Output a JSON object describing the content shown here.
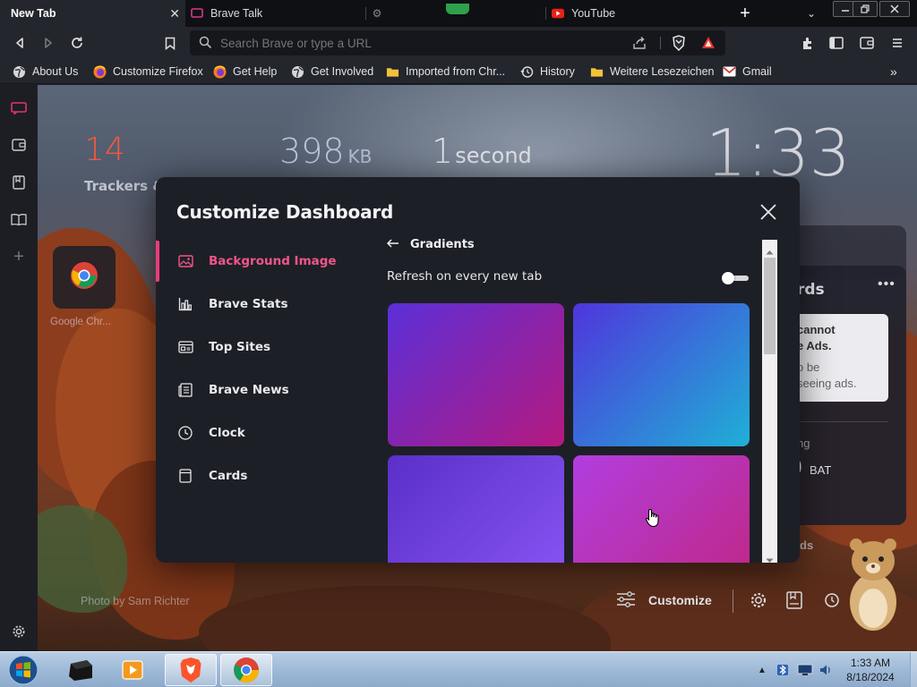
{
  "tabs": [
    {
      "label": "New Tab",
      "active": true
    },
    {
      "label": "Brave Talk",
      "active": false
    },
    {
      "label": "",
      "active": false
    },
    {
      "label": "YouTube",
      "active": false
    }
  ],
  "toolbar": {
    "url_placeholder": "Search Brave or type a URL"
  },
  "bookmarks": [
    {
      "label": "About Us",
      "icon": "globe-icon"
    },
    {
      "label": "Customize Firefox",
      "icon": "firefox-icon"
    },
    {
      "label": "Get Help",
      "icon": "firefox-icon"
    },
    {
      "label": "Get Involved",
      "icon": "globe-icon"
    },
    {
      "label": "Imported from Chr...",
      "icon": "folder-icon"
    },
    {
      "label": "History",
      "icon": "history-icon"
    },
    {
      "label": "Weitere Lesezeichen",
      "icon": "folder-icon"
    },
    {
      "label": "Gmail",
      "icon": "gmail-icon"
    }
  ],
  "background": {
    "stats": {
      "trackers_count": "14",
      "trackers_label": "Trackers &",
      "bandwidth_value": "398",
      "bandwidth_unit": "KB",
      "time_value": "1",
      "time_unit": "second"
    },
    "clock": "1:33",
    "top_site_label": "Google Chr...",
    "rewards": {
      "title_fragment": "rds",
      "notice_line1": "cannot",
      "notice_line2": "e Ads.",
      "notice_line3": "o be",
      "notice_line4": "seeing ads.",
      "earning_fragment": "ng",
      "bat_value": "0",
      "bat_unit": "BAT",
      "cards_fragment": "rds"
    },
    "photo_credit": "Photo by Sam Richter",
    "customize_label": "Customize"
  },
  "modal": {
    "title": "Customize Dashboard",
    "nav": [
      {
        "label": "Background Image",
        "icon": "image-icon",
        "active": true
      },
      {
        "label": "Brave Stats",
        "icon": "bar-chart-icon",
        "active": false
      },
      {
        "label": "Top Sites",
        "icon": "top-sites-icon",
        "active": false
      },
      {
        "label": "Brave News",
        "icon": "news-icon",
        "active": false
      },
      {
        "label": "Clock",
        "icon": "clock-icon",
        "active": false
      },
      {
        "label": "Cards",
        "icon": "cards-icon",
        "active": false
      }
    ],
    "section_title": "Gradients",
    "refresh_label": "Refresh on every new tab",
    "refresh_enabled": false,
    "gradients": [
      {
        "from": "#5b2fd8",
        "to": "#b5197e"
      },
      {
        "from": "#4f35dc",
        "to": "#1fb0d6"
      },
      {
        "from": "#5a2fc8",
        "to": "#8a56f5"
      },
      {
        "from": "#b13ee0",
        "to": "#c02682"
      }
    ]
  },
  "taskbar": {
    "time": "1:33 AM",
    "date": "8/18/2024"
  },
  "colors": {
    "accent": "#e83d7c",
    "modal_bg": "#1d1f26"
  }
}
